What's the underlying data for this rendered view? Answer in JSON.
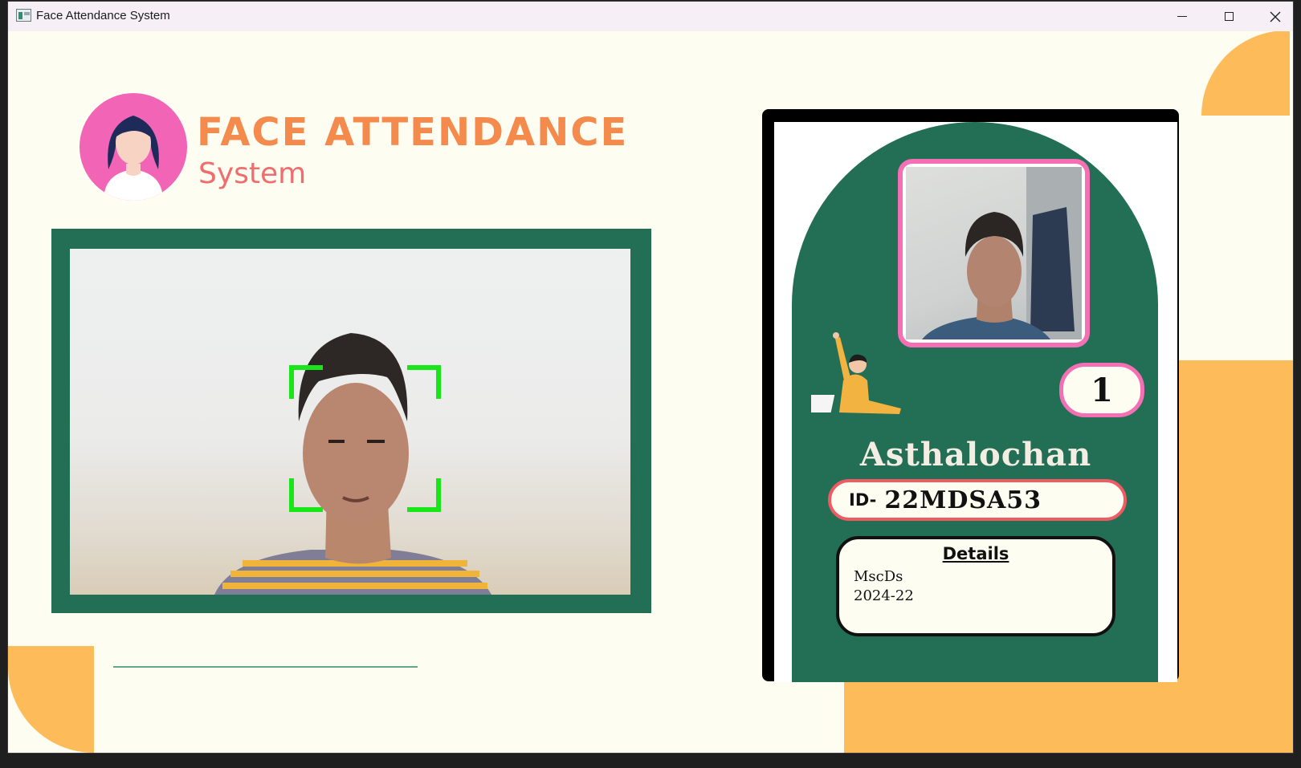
{
  "window": {
    "title": "Face Attendance System",
    "controls": {
      "minimize": "minimize",
      "maximize": "maximize",
      "close": "close"
    }
  },
  "header": {
    "title": "FACE ATTENDANCE",
    "subtitle": "System"
  },
  "student_card": {
    "number": "1",
    "name": "Asthalochan",
    "id_prefix": "ID-",
    "id_value": "22MDSA53",
    "details": {
      "heading": "Details",
      "course": "MscDs",
      "batch": "2024-22"
    }
  },
  "colors": {
    "background": "#fefdf2",
    "frame_green": "#236f55",
    "accent_orange": "#fdbb5a",
    "title_orange": "#f48a4c",
    "subtitle_coral": "#ef6d6d",
    "pink": "#f46fb4",
    "face_box_green": "#19e619"
  },
  "icons": [
    "app-icon",
    "minimize-icon",
    "maximize-icon",
    "close-icon",
    "avatar-logo-icon"
  ]
}
